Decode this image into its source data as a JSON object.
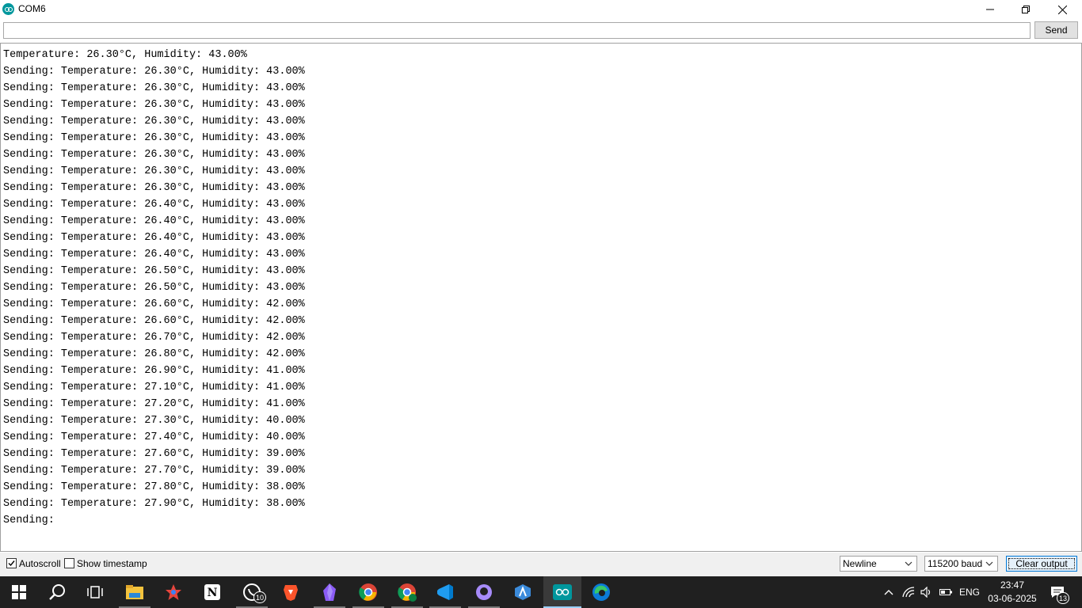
{
  "window": {
    "title": "COM6",
    "app_icon": "arduino-icon"
  },
  "send": {
    "input_value": "",
    "button_label": "Send"
  },
  "output": {
    "lines": [
      "Temperature: 26.30°C, Humidity: 43.00%",
      "Sending: Temperature: 26.30°C, Humidity: 43.00%",
      "Sending: Temperature: 26.30°C, Humidity: 43.00%",
      "Sending: Temperature: 26.30°C, Humidity: 43.00%",
      "Sending: Temperature: 26.30°C, Humidity: 43.00%",
      "Sending: Temperature: 26.30°C, Humidity: 43.00%",
      "Sending: Temperature: 26.30°C, Humidity: 43.00%",
      "Sending: Temperature: 26.30°C, Humidity: 43.00%",
      "Sending: Temperature: 26.30°C, Humidity: 43.00%",
      "Sending: Temperature: 26.40°C, Humidity: 43.00%",
      "Sending: Temperature: 26.40°C, Humidity: 43.00%",
      "Sending: Temperature: 26.40°C, Humidity: 43.00%",
      "Sending: Temperature: 26.40°C, Humidity: 43.00%",
      "Sending: Temperature: 26.50°C, Humidity: 43.00%",
      "Sending: Temperature: 26.50°C, Humidity: 43.00%",
      "Sending: Temperature: 26.60°C, Humidity: 42.00%",
      "Sending: Temperature: 26.60°C, Humidity: 42.00%",
      "Sending: Temperature: 26.70°C, Humidity: 42.00%",
      "Sending: Temperature: 26.80°C, Humidity: 42.00%",
      "Sending: Temperature: 26.90°C, Humidity: 41.00%",
      "Sending: Temperature: 27.10°C, Humidity: 41.00%",
      "Sending: Temperature: 27.20°C, Humidity: 41.00%",
      "Sending: Temperature: 27.30°C, Humidity: 40.00%",
      "Sending: Temperature: 27.40°C, Humidity: 40.00%",
      "Sending: Temperature: 27.60°C, Humidity: 39.00%",
      "Sending: Temperature: 27.70°C, Humidity: 39.00%",
      "Sending: Temperature: 27.80°C, Humidity: 38.00%",
      "Sending: Temperature: 27.90°C, Humidity: 38.00%",
      "Sending:"
    ]
  },
  "bottom": {
    "autoscroll_label": "Autoscroll",
    "autoscroll_checked": true,
    "timestamp_label": "Show timestamp",
    "timestamp_checked": false,
    "line_ending": "Newline",
    "baud_rate": "115200 baud",
    "clear_label": "Clear output"
  },
  "taskbar": {
    "apps": [
      {
        "name": "start-icon"
      },
      {
        "name": "search-icon"
      },
      {
        "name": "task-view-icon"
      },
      {
        "name": "file-explorer-icon"
      },
      {
        "name": "paint-app-icon"
      },
      {
        "name": "notion-icon"
      },
      {
        "name": "whatsapp-icon",
        "badge": "10"
      },
      {
        "name": "brave-icon"
      },
      {
        "name": "obsidian-icon"
      },
      {
        "name": "chrome-icon"
      },
      {
        "name": "chrome-profile-icon"
      },
      {
        "name": "vscode-icon"
      },
      {
        "name": "github-icon"
      },
      {
        "name": "android-studio-icon"
      },
      {
        "name": "arduino-icon",
        "active": true
      },
      {
        "name": "edge-icon"
      }
    ],
    "tray": {
      "language": "ENG",
      "time": "23:47",
      "date": "03-06-2025",
      "notifications": "13"
    }
  },
  "colors": {
    "taskbar_bg": "#202020",
    "arduino_teal": "#00979d",
    "button_focus": "#0078d7"
  }
}
